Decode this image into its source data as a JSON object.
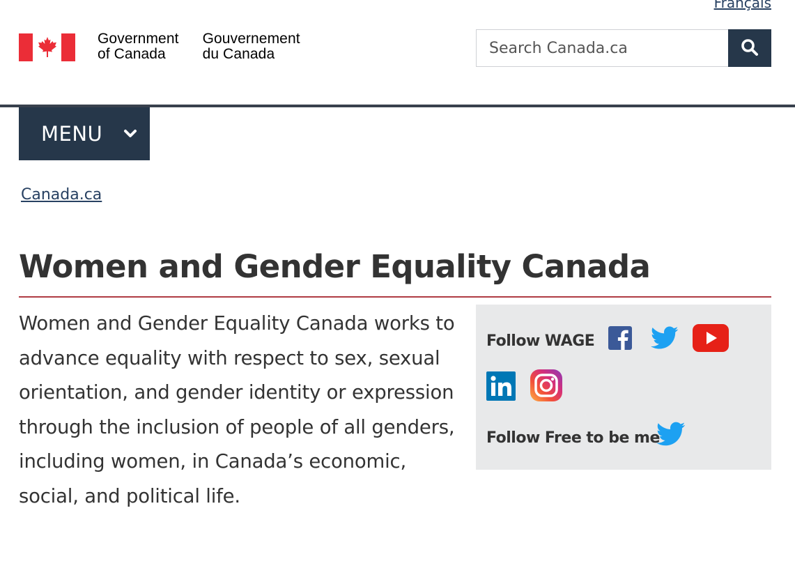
{
  "header": {
    "language_link": "Français",
    "signature": {
      "en_line1": "Government",
      "en_line2": "of Canada",
      "fr_line1": "Gouvernement",
      "fr_line2": "du Canada"
    },
    "search": {
      "placeholder": "Search Canada.ca",
      "button_icon": "search-icon"
    },
    "menu_label": "MENU"
  },
  "breadcrumb": {
    "items": [
      "Canada.ca"
    ]
  },
  "main": {
    "title": "Women and Gender Equality Canada",
    "intro": "Women and Gender Equality Canada works to advance equality with respect to sex, sexual orientation, and gender identity or expression through the inclusion of people of all genders, including women, in Canada’s economic, social, and political life."
  },
  "follow": {
    "wage_label": "Follow WAGE",
    "wage_icons": [
      "facebook-icon",
      "twitter-icon",
      "youtube-icon",
      "linkedin-icon",
      "instagram-icon"
    ],
    "free_label": "Follow Free to be me",
    "free_icons": [
      "twitter-icon"
    ]
  },
  "colors": {
    "flag_red": "#eb2d37",
    "navy": "#26374a",
    "link": "#284162",
    "title_rule": "#af3c43",
    "panel_bg": "#e8e9ea",
    "facebook": "#3b5998",
    "twitter": "#1da1f2",
    "youtube": "#e62117",
    "linkedin": "#0077b5"
  }
}
